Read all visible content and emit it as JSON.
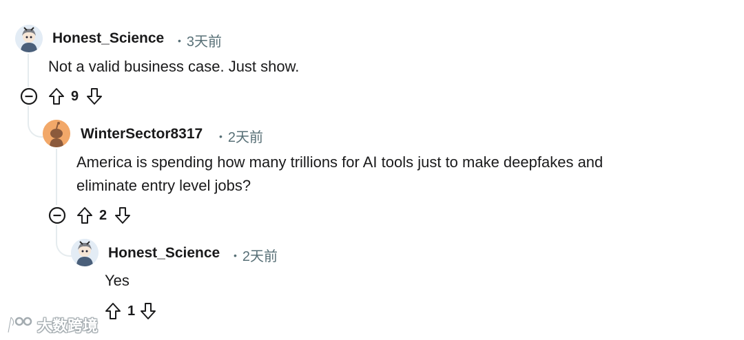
{
  "comments": [
    {
      "username": "Honest_Science",
      "time": "3天前",
      "body": "Not a valid business case. Just show.",
      "votes": "9"
    },
    {
      "username": "WinterSector8317",
      "time": "2天前",
      "body_line1": "America is spending how many trillions for AI tools just to make deepfakes and",
      "body_line2": "eliminate entry level jobs?",
      "votes": "2"
    },
    {
      "username": "Honest_Science",
      "time": "2天前",
      "body": "Yes",
      "votes": "1"
    }
  ],
  "watermark": "大数跨境",
  "colors": {
    "thread_line": "#e5ebee",
    "meta_text": "#576f76",
    "avatar_orange": "#f2a869"
  }
}
